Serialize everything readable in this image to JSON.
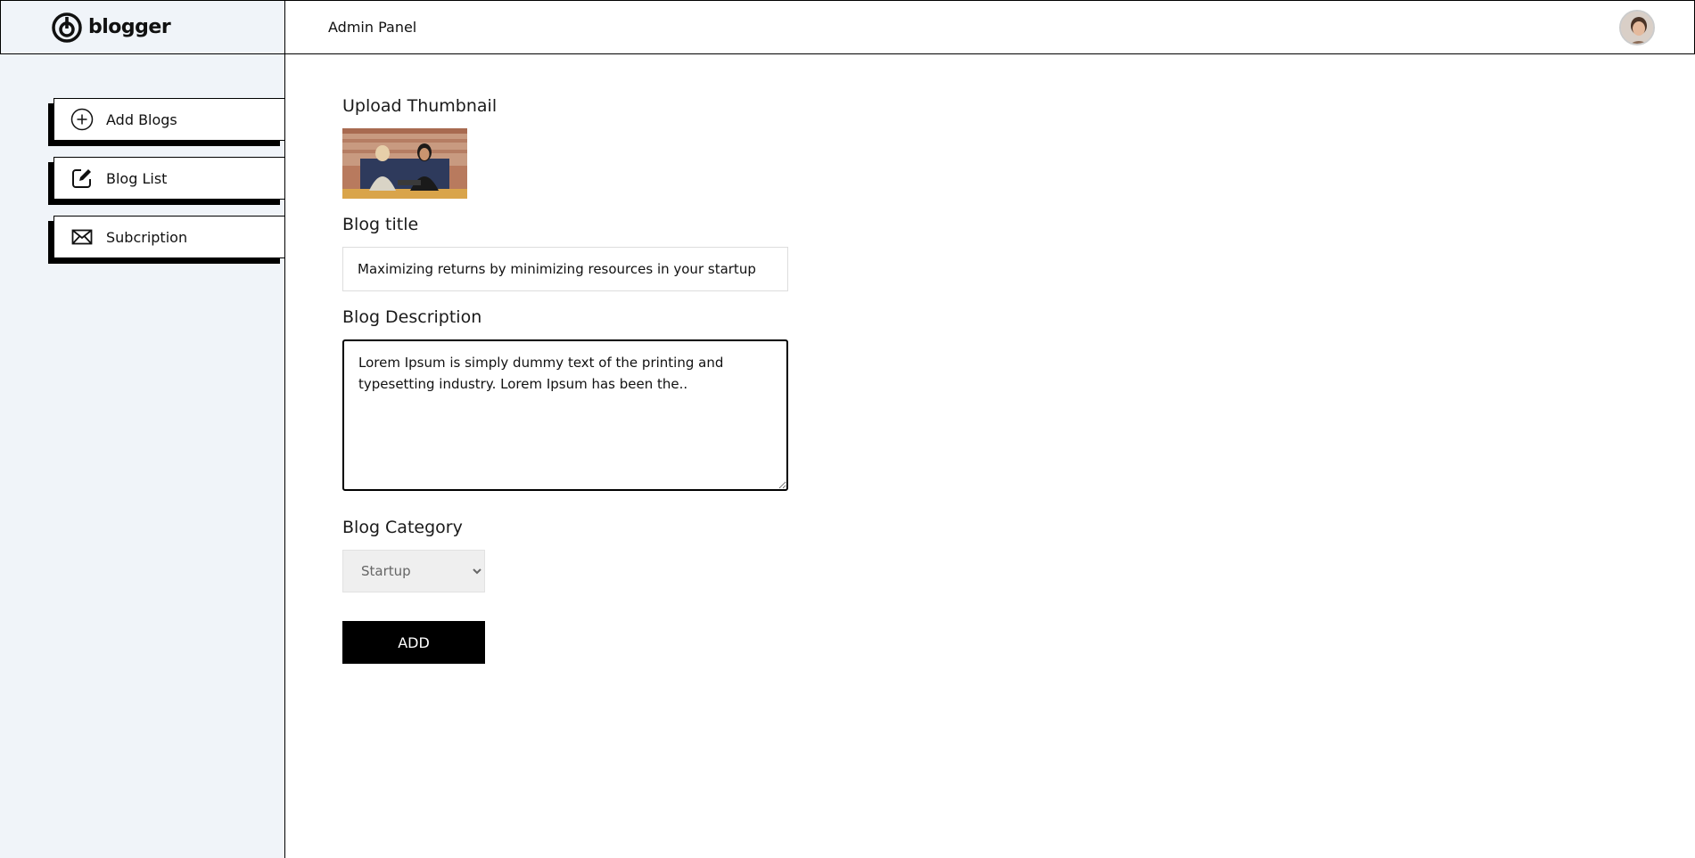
{
  "brand": {
    "name": "blogger",
    "logo_icon": "blogger-logo-icon"
  },
  "header": {
    "title": "Admin Panel",
    "avatar_icon": "user-avatar"
  },
  "sidebar": {
    "items": [
      {
        "label": "Add Blogs",
        "icon": "plus-circle-icon"
      },
      {
        "label": "Blog List",
        "icon": "edit-icon"
      },
      {
        "label": "Subcription",
        "icon": "mail-icon"
      }
    ]
  },
  "form": {
    "thumbnail_label": "Upload Thumbnail",
    "title_label": "Blog title",
    "title_value": "Maximizing returns by minimizing resources in your startup",
    "description_label": "Blog Description",
    "description_value": "Lorem Ipsum is simply dummy text of the printing and typesetting industry. Lorem Ipsum has been the..",
    "category_label": "Blog Category",
    "category_selected": "Startup",
    "submit_label": "ADD"
  }
}
